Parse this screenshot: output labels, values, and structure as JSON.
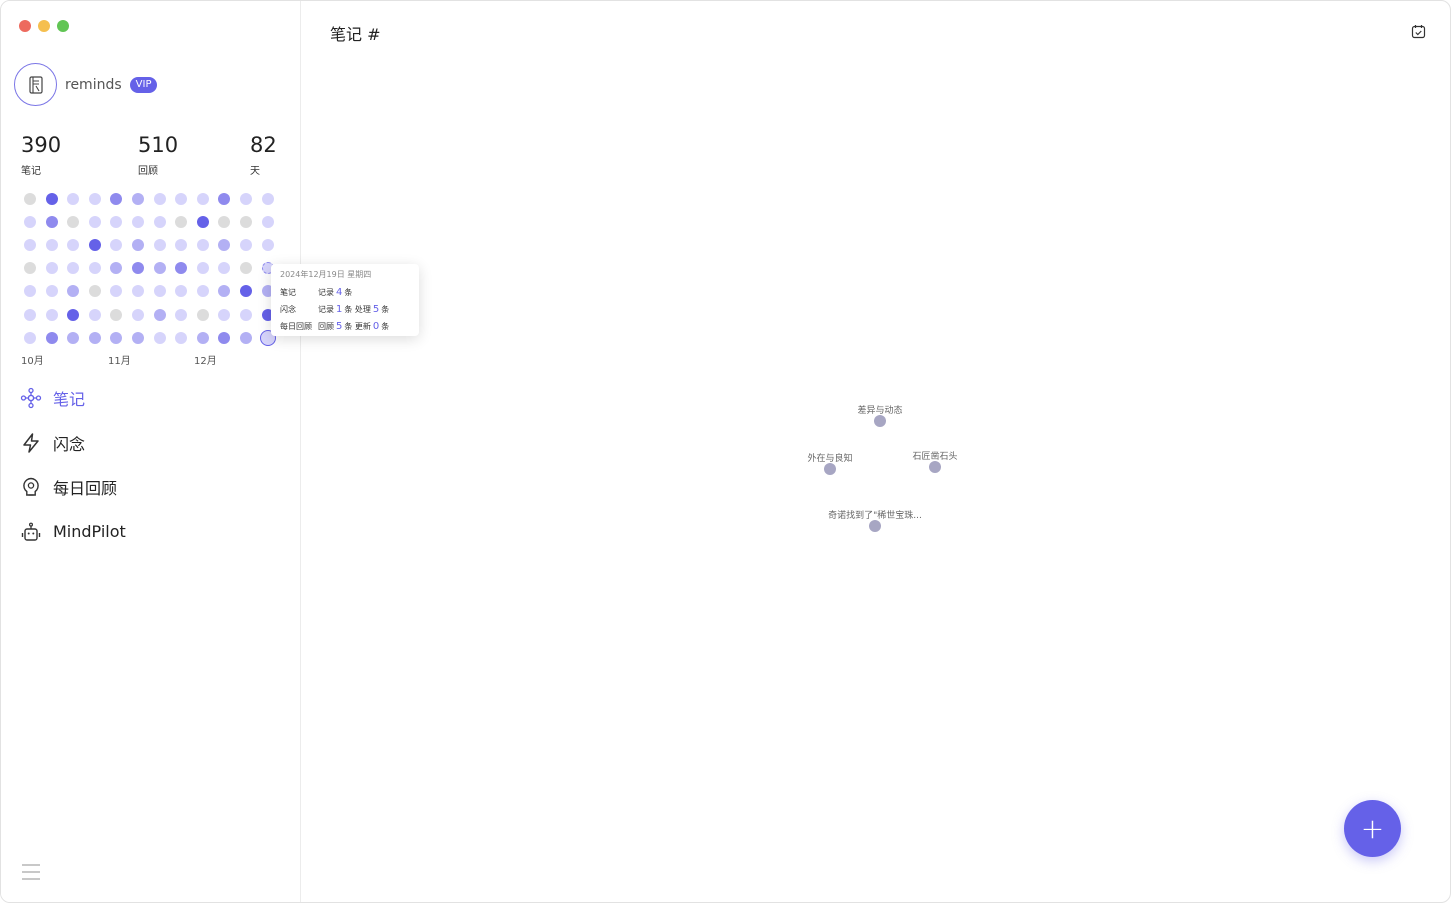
{
  "sidebar": {
    "username": "reminds",
    "badge": "VIP",
    "stats": [
      {
        "value": "390",
        "label": "笔记"
      },
      {
        "value": "510",
        "label": "回顾"
      },
      {
        "value": "82",
        "label": "天"
      }
    ],
    "heatmap": {
      "levels": [
        [
          0,
          4,
          1,
          1,
          3,
          2,
          1,
          1,
          1,
          3,
          1,
          1
        ],
        [
          1,
          3,
          0,
          1,
          1,
          1,
          1,
          0,
          4,
          0,
          0,
          1
        ],
        [
          1,
          1,
          1,
          4,
          1,
          2,
          1,
          1,
          1,
          2,
          1,
          1
        ],
        [
          0,
          1,
          1,
          1,
          2,
          3,
          2,
          3,
          1,
          1,
          0,
          1
        ],
        [
          1,
          1,
          2,
          0,
          1,
          1,
          1,
          1,
          1,
          2,
          4,
          2
        ],
        [
          1,
          1,
          4,
          1,
          0,
          1,
          2,
          1,
          0,
          1,
          1,
          4
        ],
        [
          1,
          3,
          2,
          2,
          2,
          2,
          1,
          1,
          2,
          3,
          2,
          1
        ]
      ],
      "months": [
        "10月",
        "11月",
        "12月"
      ],
      "hover_cell": [
        3,
        11
      ],
      "selected_cell": [
        6,
        11
      ]
    },
    "tooltip": {
      "date": "2024年12月19日   星期四",
      "rows": [
        {
          "label": "笔记",
          "parts": [
            "记录",
            "4",
            "条"
          ]
        },
        {
          "label": "闪念",
          "parts": [
            "记录",
            "1",
            "条 处理",
            "5",
            "条"
          ]
        },
        {
          "label": "每日回顾",
          "parts": [
            "回顾",
            "5",
            "条 更新",
            "0",
            "条"
          ]
        }
      ]
    },
    "nav": [
      {
        "label": "笔记",
        "icon": "graph-nodes-icon",
        "active": true
      },
      {
        "label": "闪念",
        "icon": "lightning-icon",
        "active": false
      },
      {
        "label": "每日回顾",
        "icon": "brain-bulb-icon",
        "active": false
      },
      {
        "label": "MindPilot",
        "icon": "robot-icon",
        "active": false
      }
    ]
  },
  "main": {
    "title": "笔记 #",
    "graph_nodes": [
      {
        "label": "差异与动态"
      },
      {
        "label": "外在与良知"
      },
      {
        "label": "石匠凿石头"
      },
      {
        "label": "奇诺找到了\"稀世宝珠..."
      }
    ],
    "fab_label": "+"
  },
  "colors": {
    "accent": "#6561e8",
    "node": "#a7a6c3"
  }
}
